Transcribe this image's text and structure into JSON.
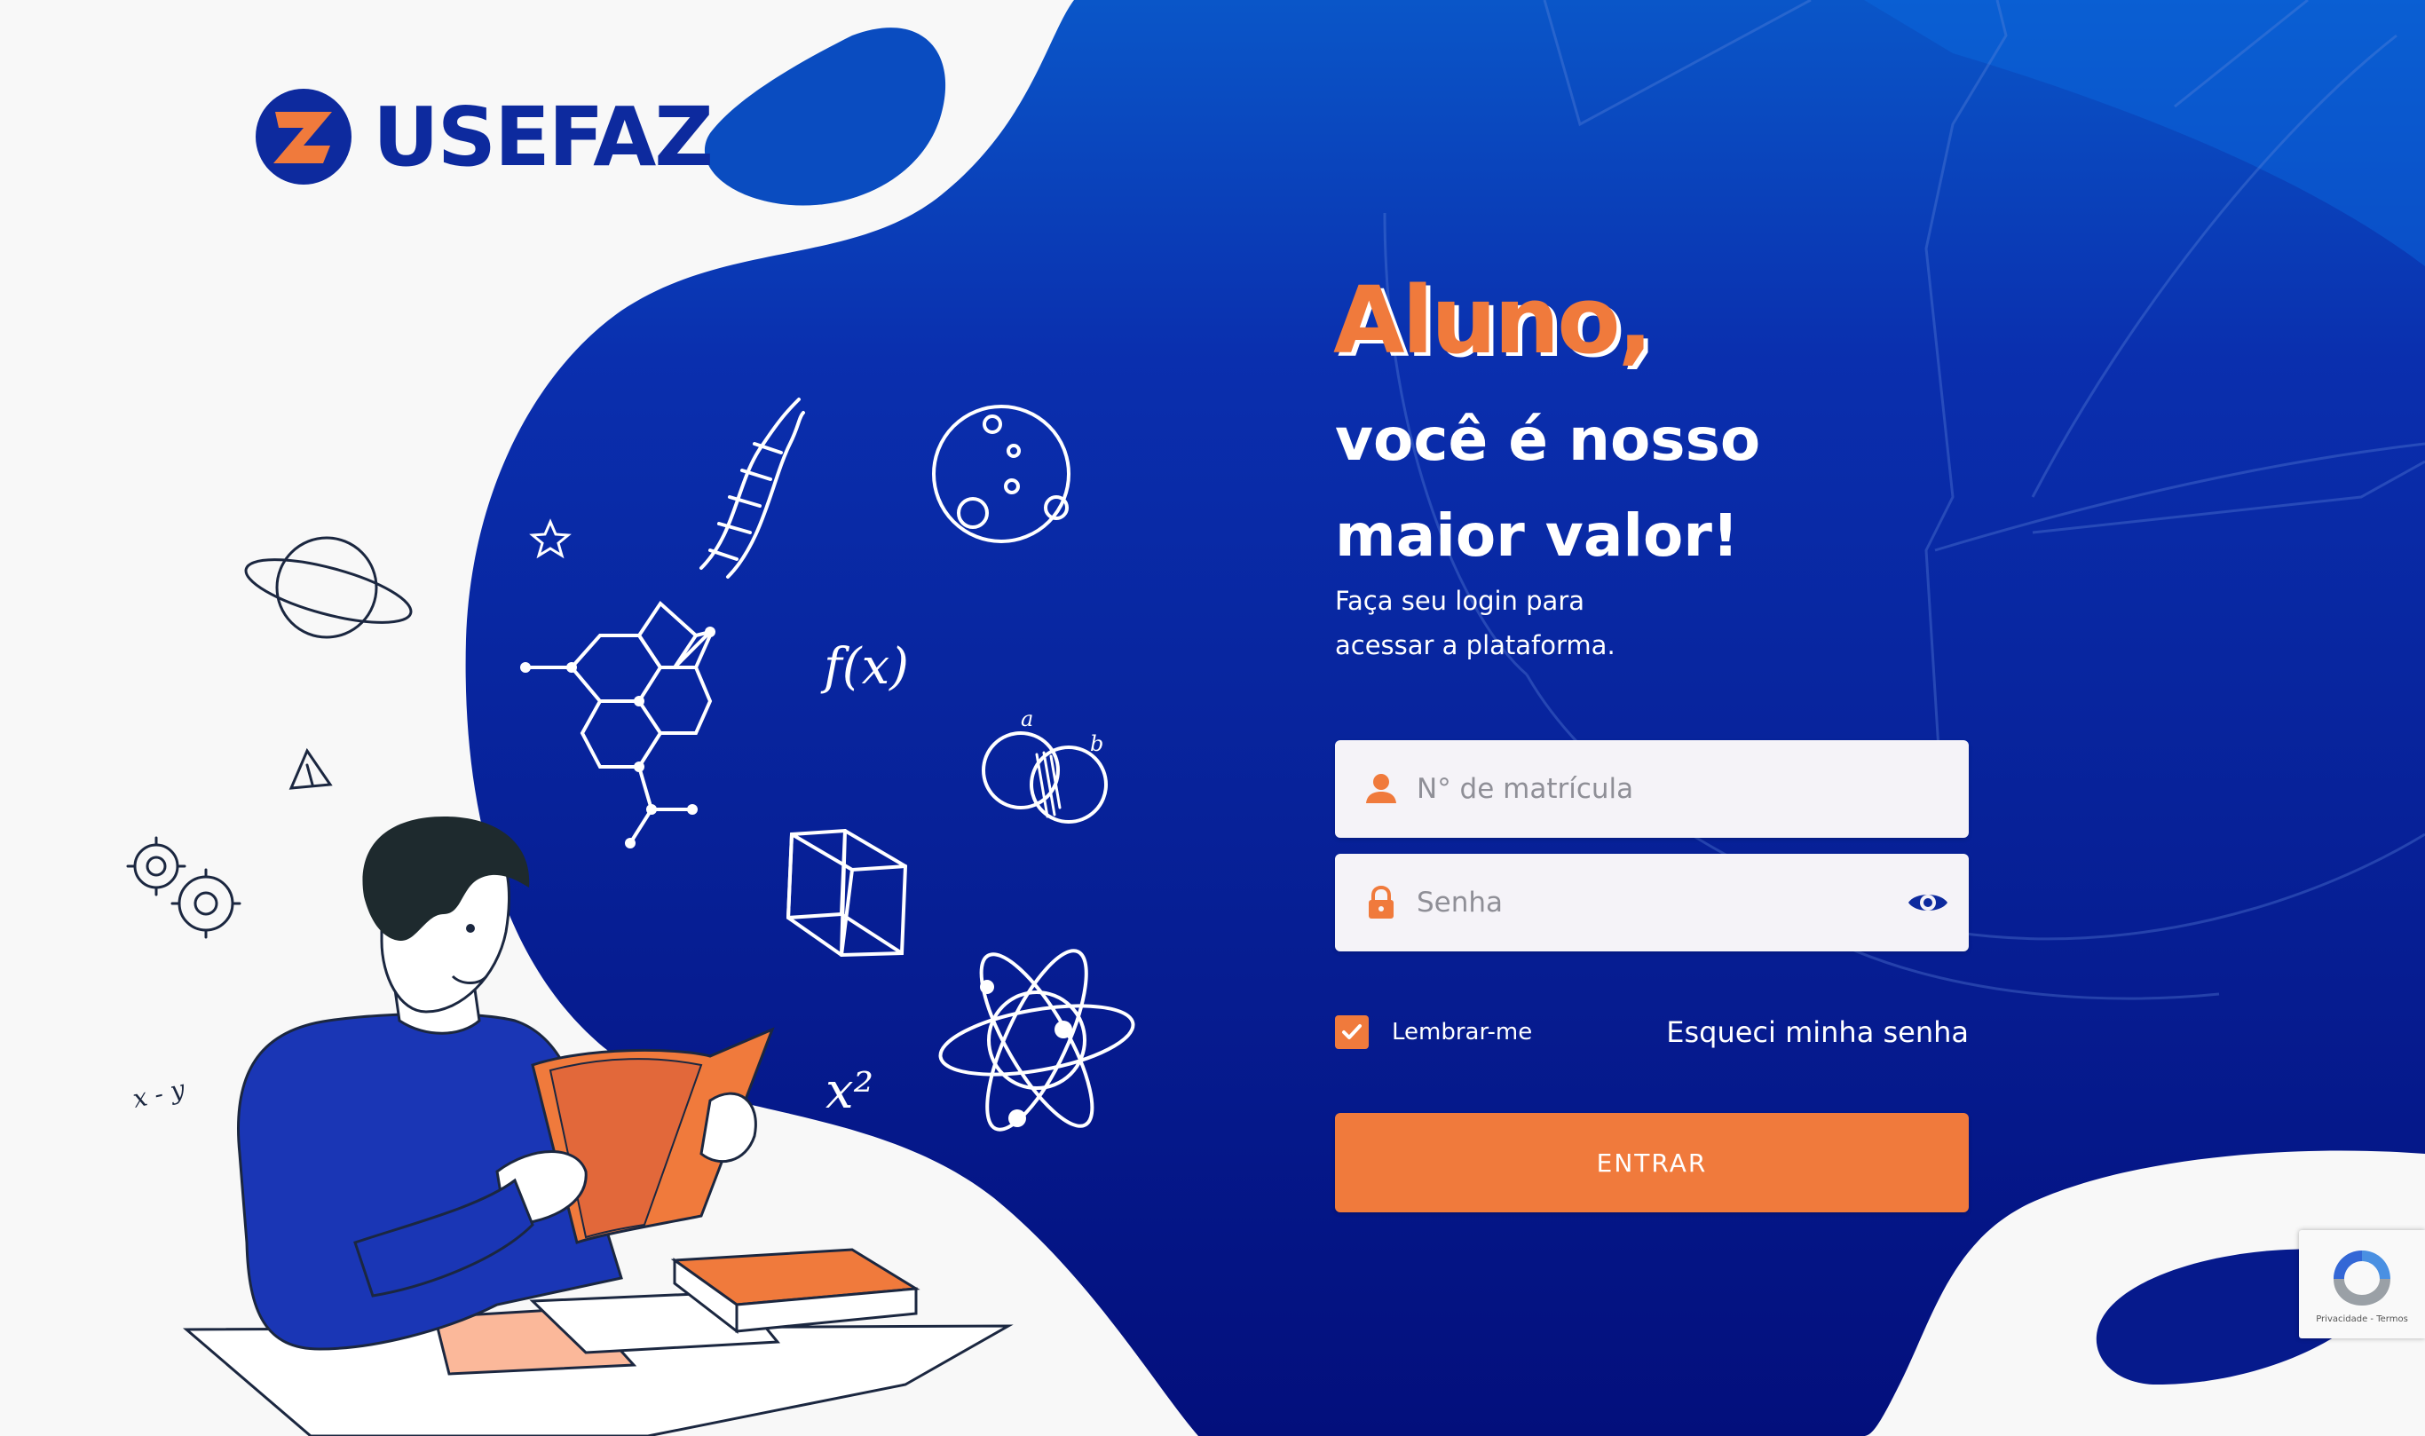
{
  "brand": {
    "name": "USEFAZ"
  },
  "hero": {
    "title": "Aluno,",
    "subtitle_line1": "você é nosso",
    "subtitle_line2": "maior valor!",
    "desc_line1": "Faça seu login para",
    "desc_line2": "acessar a plataforma."
  },
  "form": {
    "matricula_placeholder": "N° de matrícula",
    "senha_placeholder": "Senha",
    "remember_label": "Lembrar-me",
    "remember_checked": true,
    "forgot_link": "Esqueci minha senha",
    "submit_label": "ENTRAR"
  },
  "illustration_labels": {
    "formula_fx": "f(x)",
    "set_a": "a",
    "set_b": "b",
    "x_squared": "x²",
    "x_minus_y": "x - y"
  },
  "recaptcha": {
    "links": "Privacidade - Termos"
  },
  "colors": {
    "brand_blue": "#0d2a9e",
    "deep_blue": "#061a8c",
    "accent_orange": "#f07a3c",
    "background": "#f8f8f8"
  },
  "icons": [
    "user-icon",
    "lock-icon",
    "eye-icon",
    "check-icon",
    "recaptcha-icon"
  ]
}
